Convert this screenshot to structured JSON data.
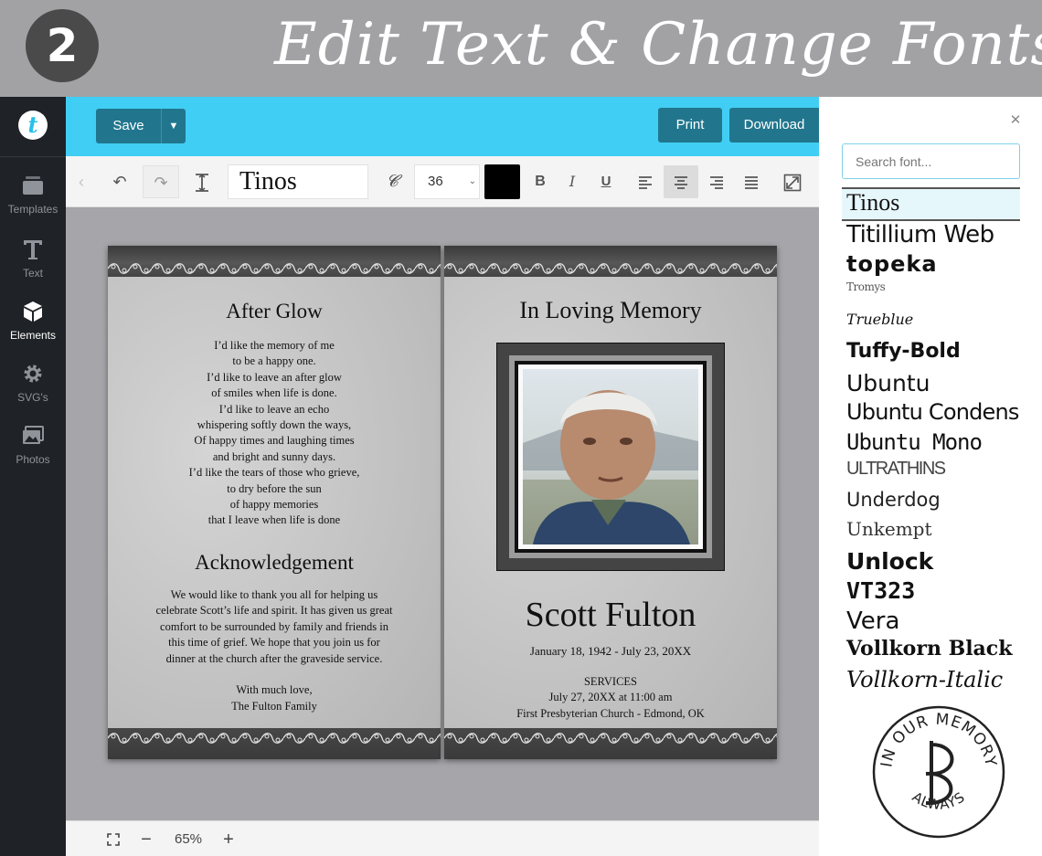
{
  "banner": {
    "step_number": "2",
    "title": "Edit Text & Change Fonts"
  },
  "sidebar": {
    "logo_letter": "t",
    "items": [
      {
        "label": "Templates",
        "icon": "templates-icon",
        "active": false
      },
      {
        "label": "Text",
        "icon": "text-icon",
        "active": false
      },
      {
        "label": "Elements",
        "icon": "cube-icon",
        "active": true
      },
      {
        "label": "SVG's",
        "icon": "gear-icon",
        "active": false
      },
      {
        "label": "Photos",
        "icon": "photos-icon",
        "active": false
      }
    ]
  },
  "topbar": {
    "save_label": "Save",
    "print_label": "Print",
    "download_label": "Download"
  },
  "toolbar": {
    "font_name": "Tinos",
    "font_size": "36",
    "text_color": "#000000",
    "bold_label": "B",
    "italic_label": "I",
    "underline_label": "U",
    "alignment": "center"
  },
  "left_page": {
    "poem_title": "After Glow",
    "poem_lines": [
      "I’d like the memory of me",
      "to be a happy one.",
      "I’d like to leave an after glow",
      "of smiles when life is done.",
      "I’d like to leave an echo",
      "whispering softly down the ways,",
      "Of happy times and laughing times",
      "and bright and sunny days.",
      "I’d like the tears of those who grieve,",
      "to dry before the sun",
      "of happy memories",
      "that I leave when life is done"
    ],
    "ack_title": "Acknowledgement",
    "ack_lines": [
      "We would like to thank you all for helping us",
      "celebrate Scott’s life and spirit. It has given us great",
      "comfort to be surrounded by family and friends in",
      "this time of grief. We hope that you join us for",
      "dinner at the church after the graveside service."
    ],
    "closing": "With much love,",
    "signature": "The Fulton Family"
  },
  "right_page": {
    "heading": "In Loving Memory",
    "name": "Scott Fulton",
    "dates": "January 18, 1942 - July 23, 20XX",
    "services_label": "SERVICES",
    "service_time": "July 27, 20XX at 11:00 am",
    "service_place": "First Presbyterian Church - Edmond, OK"
  },
  "zoom": {
    "level": "65%"
  },
  "font_panel": {
    "search_placeholder": "Search font...",
    "fonts": [
      "Tinos",
      "Titillium Web",
      "topeka",
      "Tromys",
      "Trueblue",
      "Tuffy-Bold",
      "Ubuntu",
      "Ubuntu Condensed",
      "Ubuntu Mono",
      "ULTRATHINS",
      "Underdog",
      "Unkempt",
      "Unlock",
      "VT323",
      "Vera",
      "Vollkorn Black",
      "Vollkorn-Italic"
    ],
    "selected_font": "Tinos"
  },
  "seal": {
    "top_text": "IN OUR MEMORY",
    "bottom_text": "ALWAYS"
  }
}
